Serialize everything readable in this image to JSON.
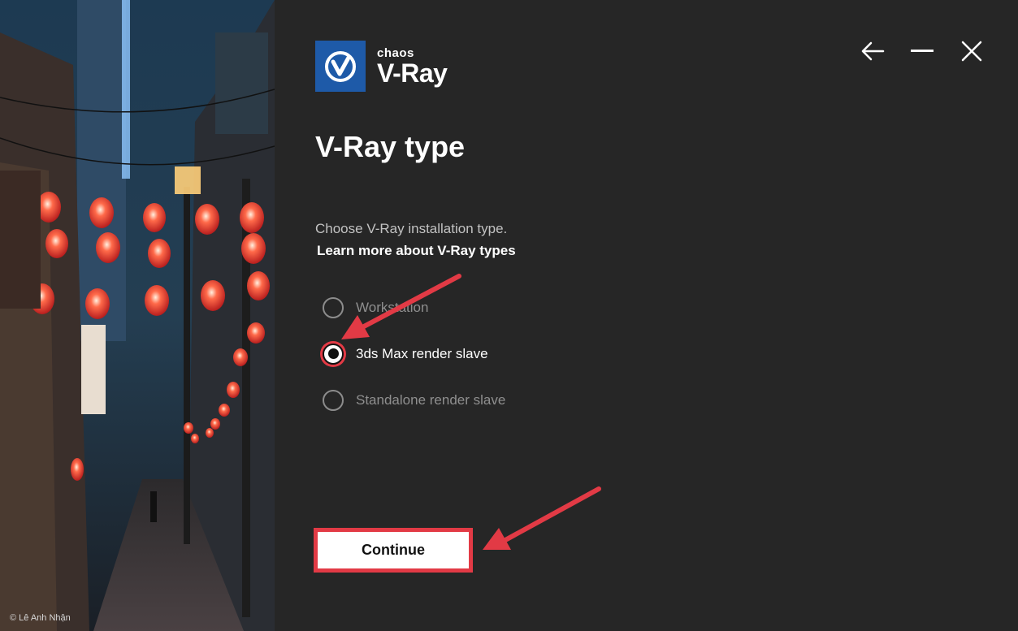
{
  "photo": {
    "credit": "© Lê Anh Nhận"
  },
  "logo": {
    "brand": "chaos",
    "product": "V-Ray"
  },
  "window_controls": {
    "back_icon": "arrow-left-icon",
    "minimize_icon": "minimize-icon",
    "close_icon": "close-icon"
  },
  "page": {
    "title": "V-Ray type",
    "description": "Choose V-Ray installation type.",
    "learn_more": "Learn more about V-Ray types"
  },
  "options": [
    {
      "label": "Workstation",
      "selected": false
    },
    {
      "label": "3ds Max render slave",
      "selected": true
    },
    {
      "label": "Standalone render slave",
      "selected": false
    }
  ],
  "continue_label": "Continue",
  "colors": {
    "panel_bg": "#262626",
    "logo_blue": "#1e5aa8",
    "annotation_red": "#e23a45"
  }
}
